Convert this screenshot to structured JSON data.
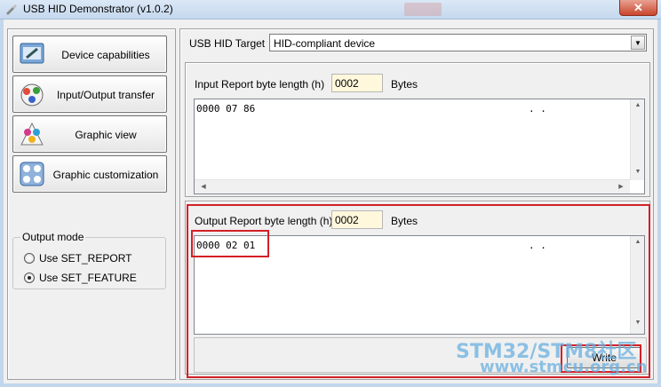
{
  "window": {
    "title": "USB HID Demonstrator (v1.0.2)",
    "close_glyph": "✕"
  },
  "nav": [
    {
      "label": "Device capabilities",
      "icon": "device-capabilities-icon"
    },
    {
      "label": "Input/Output transfer",
      "icon": "io-transfer-icon"
    },
    {
      "label": "Graphic view",
      "icon": "graphic-view-icon"
    },
    {
      "label": "Graphic customization",
      "icon": "graphic-customization-icon"
    }
  ],
  "output_mode": {
    "legend": "Output mode",
    "options": [
      {
        "label": "Use SET_REPORT",
        "selected": false
      },
      {
        "label": "Use SET_FEATURE",
        "selected": true
      }
    ]
  },
  "target": {
    "label": "USB HID Target",
    "value": "HID-compliant device"
  },
  "input_report": {
    "length_label": "Input Report byte length  (h)",
    "length_value": "0002",
    "bytes_label": "Bytes",
    "data": "0000 07 86",
    "dots": ". ."
  },
  "output_report": {
    "length_label": "Output Report byte length  (h)",
    "length_value": "0002",
    "bytes_label": "Bytes",
    "data": "0000 02 01",
    "dots": ". ."
  },
  "write_button": "Write",
  "watermark": {
    "line1": "STM32/STM8社区",
    "line2": "www.stmcu.org.cn"
  },
  "colors": {
    "highlight_red": "#d32027",
    "length_field_bg": "#fff8dc",
    "watermark_blue": "#6ab0e0"
  }
}
